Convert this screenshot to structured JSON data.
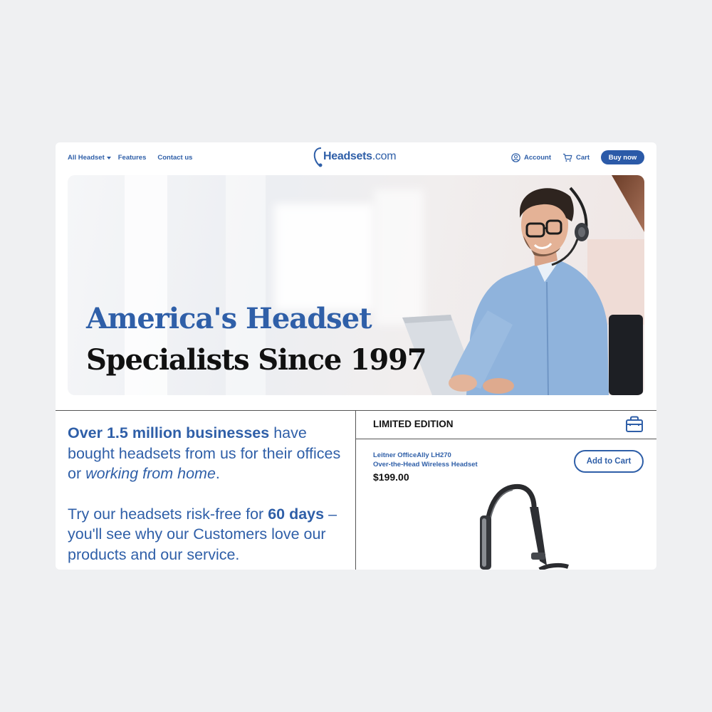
{
  "nav": {
    "links": [
      {
        "label": "All Headset",
        "has_dropdown": true
      },
      {
        "label": "Features"
      },
      {
        "label": "Contact us"
      }
    ],
    "logo": {
      "bold": "Headsets",
      "suffix": ".com"
    },
    "account_label": "Account",
    "cart_label": "Cart",
    "buy_label": "Buy now",
    "icons": {
      "account": "user-circle-icon",
      "cart": "shopping-cart-icon"
    }
  },
  "hero": {
    "line1": "America's Headset",
    "line2": "Specialists Since 1997"
  },
  "promo": {
    "p1_bold": "Over 1.5 million businesses",
    "p1_rest": " have bought headsets from us for their offices or ",
    "p1_italic": "working from home",
    "p1_end": ".",
    "p2_start": "Try our headsets risk-free for ",
    "p2_bold": "60 days",
    "p2_rest": " – you'll see why our Customers love our products and our service."
  },
  "product": {
    "section_title": "LIMITED EDITION",
    "name_line1": "Leitner OfficeAlly LH270",
    "name_line2": "Over-the-Head Wireless Headset",
    "price": "$199.00",
    "cart_button": "Add to Cart",
    "icon": "shopping-bag-icon"
  },
  "colors": {
    "brand_blue": "#2f5fa8",
    "button_blue": "#2b5aa8",
    "background": "#eff0f2"
  }
}
